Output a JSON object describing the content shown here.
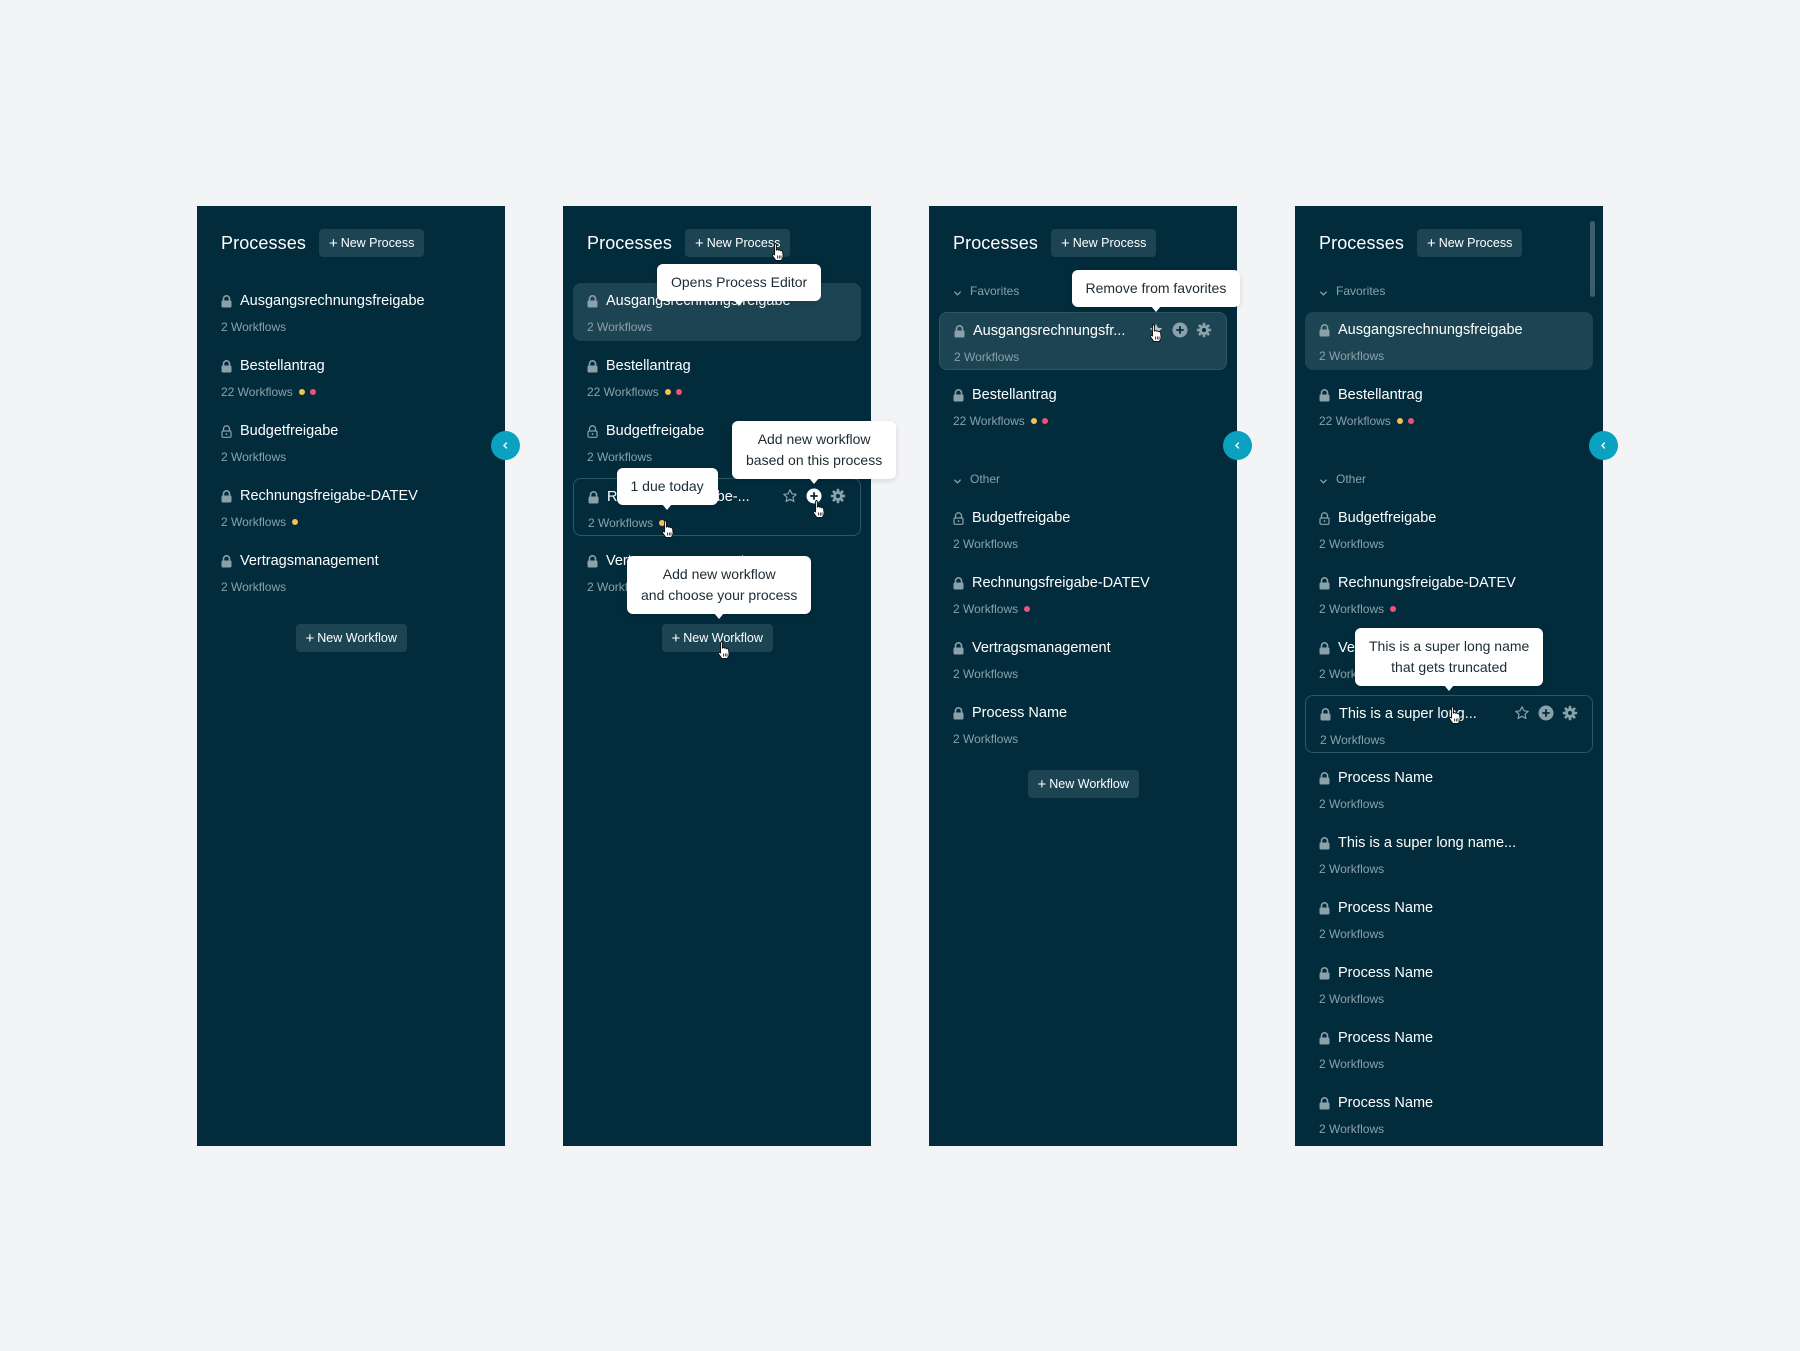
{
  "colors": {
    "panel_bg": "#022c3c",
    "accent": "#0aa2c0",
    "dot_yellow": "#f2c14e",
    "dot_pink": "#f0517a",
    "button_bg": "#1d4452"
  },
  "header": {
    "title": "Processes",
    "new_process_label": "New Process"
  },
  "new_workflow_label": "New Workflow",
  "collapse_icon": "chevron-left-icon",
  "panels": [
    {
      "items": [
        {
          "name": "Ausgangsrechnungsfreigabe",
          "lock": "locked",
          "workflows": "2 Workflows",
          "dots": []
        },
        {
          "name": "Bestellantrag",
          "lock": "locked",
          "workflows": "22 Workflows",
          "dots": [
            "yellow",
            "pink"
          ]
        },
        {
          "name": "Budgetfreigabe",
          "lock": "unlocked",
          "workflows": "2 Workflows",
          "dots": []
        },
        {
          "name": "Rechnungsfreigabe-DATEV",
          "lock": "locked",
          "workflows": "2 Workflows",
          "dots": [
            "yellow"
          ]
        },
        {
          "name": "Vertragsmanagement",
          "lock": "locked",
          "workflows": "2 Workflows",
          "dots": []
        }
      ]
    },
    {
      "items": [
        {
          "name": "Ausgangsrechnungsfreigabe",
          "lock": "locked",
          "workflows": "2 Workflows",
          "dots": [],
          "state": "highlighted"
        },
        {
          "name": "Bestellantrag",
          "lock": "locked",
          "workflows": "22 Workflows",
          "dots": [
            "yellow",
            "pink"
          ]
        },
        {
          "name": "Budgetfreigabe",
          "lock": "unlocked",
          "workflows": "2 Workflows",
          "dots": []
        },
        {
          "name": "Rechnungsfreigabe-...",
          "lock": "locked",
          "workflows": "2 Workflows",
          "dots": [
            "yellow"
          ],
          "state": "hover"
        },
        {
          "name": "Vertragsmanagement",
          "lock": "locked",
          "workflows": "2 Workflows",
          "dots": []
        }
      ],
      "tooltips": {
        "new_process": "Opens Process Editor",
        "add_workflow_process": [
          "Add new workflow",
          "based on this process"
        ],
        "due_today": "1 due today",
        "new_workflow": [
          "Add new workflow",
          "and choose your process"
        ]
      }
    },
    {
      "groups": [
        {
          "label": "Favorites",
          "items": [
            {
              "name": "Ausgangsrechnungsfr...",
              "lock": "locked",
              "workflows": "2 Workflows",
              "dots": [],
              "state": "hover-highlighted"
            },
            {
              "name": "Bestellantrag",
              "lock": "locked",
              "workflows": "22 Workflows",
              "dots": [
                "yellow",
                "pink"
              ]
            }
          ]
        },
        {
          "label": "Other",
          "items": [
            {
              "name": "Budgetfreigabe",
              "lock": "unlocked",
              "workflows": "2 Workflows",
              "dots": []
            },
            {
              "name": "Rechnungsfreigabe-DATEV",
              "lock": "locked",
              "workflows": "2 Workflows",
              "dots": [
                "pink"
              ]
            },
            {
              "name": "Vertragsmanagement",
              "lock": "locked",
              "workflows": "2 Workflows",
              "dots": []
            },
            {
              "name": "Process Name",
              "lock": "locked",
              "workflows": "2 Workflows",
              "dots": []
            }
          ]
        }
      ],
      "tooltips": {
        "remove_favorite": "Remove from favorites"
      }
    },
    {
      "groups": [
        {
          "label": "Favorites",
          "items": [
            {
              "name": "Ausgangsrechnungsfreigabe",
              "lock": "locked",
              "workflows": "2 Workflows",
              "dots": [],
              "state": "highlighted"
            },
            {
              "name": "Bestellantrag",
              "lock": "locked",
              "workflows": "22 Workflows",
              "dots": [
                "yellow",
                "pink"
              ]
            }
          ]
        },
        {
          "label": "Other",
          "items": [
            {
              "name": "Budgetfreigabe",
              "lock": "unlocked",
              "workflows": "2 Workflows",
              "dots": []
            },
            {
              "name": "Rechnungsfreigabe-DATEV",
              "lock": "locked",
              "workflows": "2 Workflows",
              "dots": [
                "pink"
              ]
            },
            {
              "name": "Vertragsmanagement",
              "lock": "locked",
              "workflows": "2 Workflows",
              "dots": []
            },
            {
              "name": "This is a super long...",
              "lock": "locked",
              "workflows": "2 Workflows",
              "dots": [],
              "state": "hover"
            },
            {
              "name": "Process Name",
              "lock": "locked",
              "workflows": "2 Workflows",
              "dots": []
            },
            {
              "name": "This is a super long name...",
              "lock": "locked",
              "workflows": "2 Workflows",
              "dots": []
            },
            {
              "name": "Process Name",
              "lock": "locked",
              "workflows": "2 Workflows",
              "dots": []
            },
            {
              "name": "Process Name",
              "lock": "locked",
              "workflows": "2 Workflows",
              "dots": []
            },
            {
              "name": "Process Name",
              "lock": "locked",
              "workflows": "2 Workflows",
              "dots": []
            },
            {
              "name": "Process Name",
              "lock": "locked",
              "workflows": "2 Workflows",
              "dots": []
            }
          ]
        }
      ],
      "tooltips": {
        "truncated_name": [
          "This is a super long name",
          "that gets truncated"
        ]
      }
    }
  ]
}
